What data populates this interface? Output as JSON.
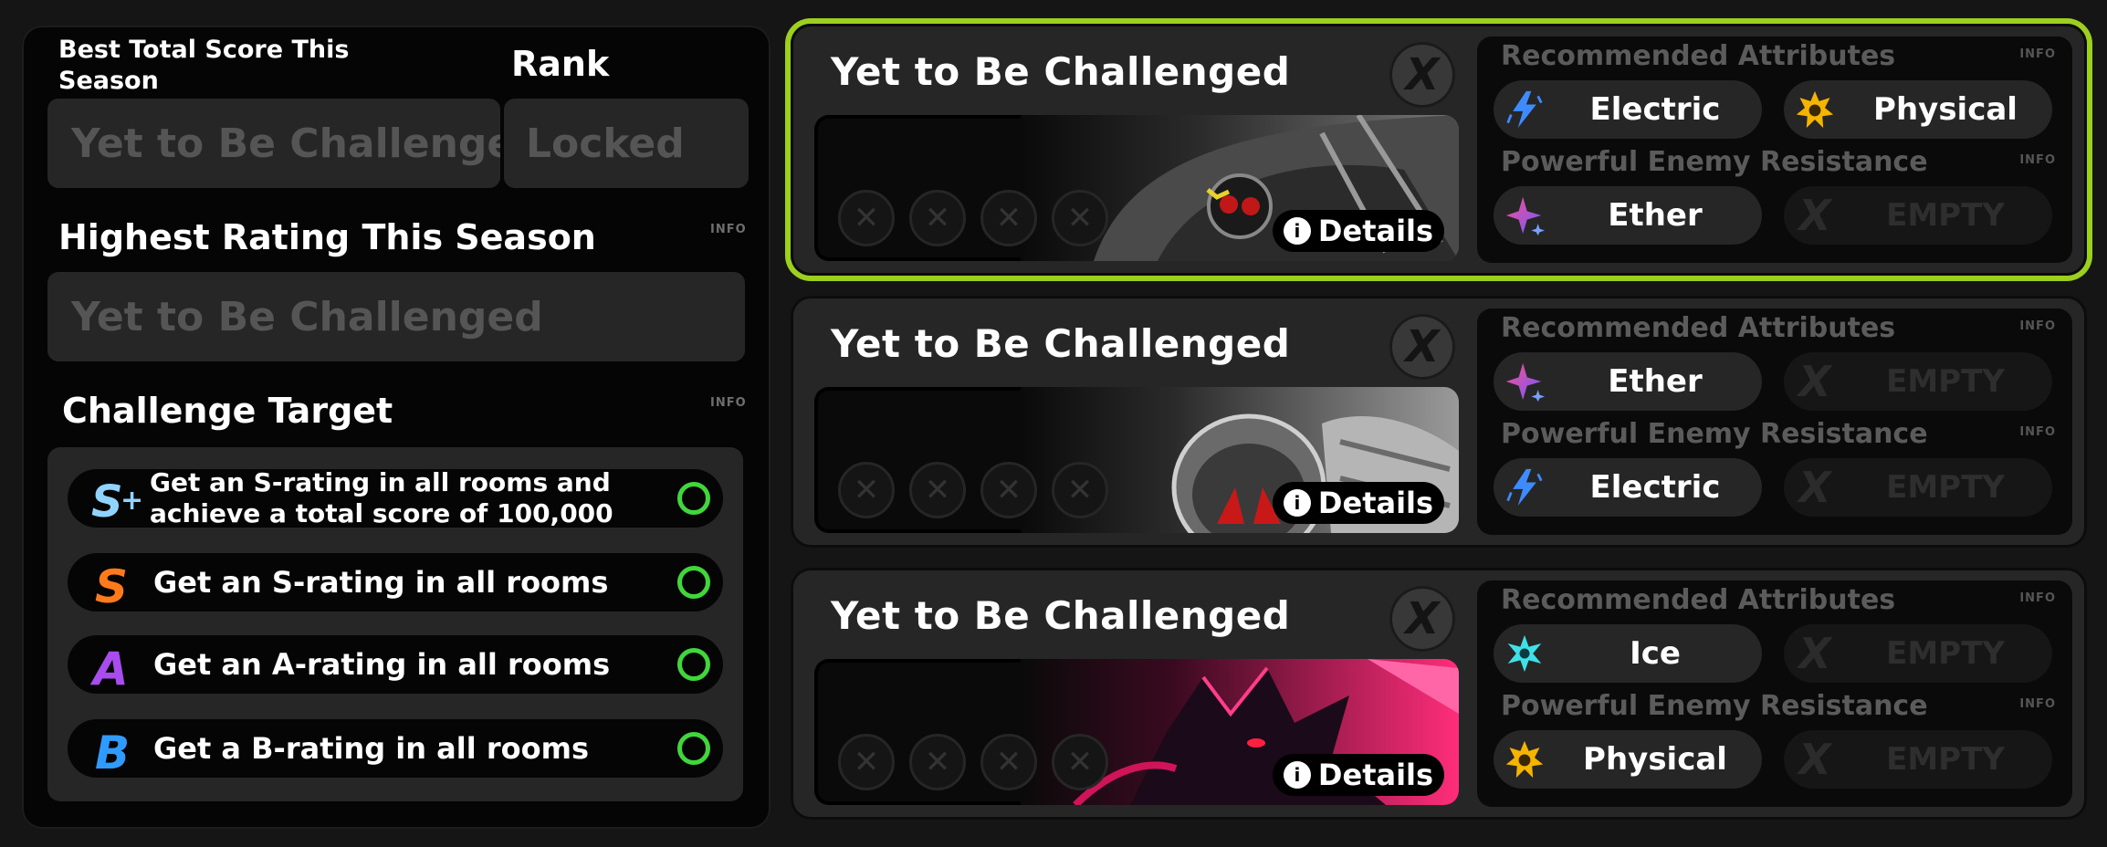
{
  "left": {
    "best_total_label": "Best Total Score This Season",
    "best_total_value": "Yet to Be Challenged",
    "rank_label": "Rank",
    "rank_value": "Locked",
    "highest_rating_label": "Highest Rating This Season",
    "highest_rating_value": "Yet to Be Challenged",
    "info_label": "INFO",
    "challenge_target_label": "Challenge Target",
    "targets": [
      {
        "badge": "S+",
        "text": "Get an S-rating in all rooms and achieve a total score of 100,000"
      },
      {
        "badge": "S",
        "text": "Get an S-rating in all rooms"
      },
      {
        "badge": "A",
        "text": "Get an A-rating in all rooms"
      },
      {
        "badge": "B",
        "text": "Get a B-rating in all rooms"
      }
    ]
  },
  "stages": [
    {
      "title": "Yet to Be Challenged",
      "close_glyph": "X",
      "details_label": "Details",
      "recommended_label": "Recommended Attributes",
      "resistance_label": "Powerful Enemy Resistance",
      "info_label": "INFO",
      "recommended": [
        {
          "name": "Electric",
          "icon": "electric-icon"
        },
        {
          "name": "Physical",
          "icon": "physical-icon"
        }
      ],
      "resistance": [
        {
          "name": "Ether",
          "icon": "ether-icon"
        },
        {
          "name": "EMPTY",
          "icon": "empty-icon"
        }
      ],
      "selected": true
    },
    {
      "title": "Yet to Be Challenged",
      "close_glyph": "X",
      "details_label": "Details",
      "recommended_label": "Recommended Attributes",
      "resistance_label": "Powerful Enemy Resistance",
      "info_label": "INFO",
      "recommended": [
        {
          "name": "Ether",
          "icon": "ether-icon"
        },
        {
          "name": "EMPTY",
          "icon": "empty-icon"
        }
      ],
      "resistance": [
        {
          "name": "Electric",
          "icon": "electric-icon"
        },
        {
          "name": "EMPTY",
          "icon": "empty-icon"
        }
      ],
      "selected": false
    },
    {
      "title": "Yet to Be Challenged",
      "close_glyph": "X",
      "details_label": "Details",
      "recommended_label": "Recommended Attributes",
      "resistance_label": "Powerful Enemy Resistance",
      "info_label": "INFO",
      "recommended": [
        {
          "name": "Ice",
          "icon": "ice-icon"
        },
        {
          "name": "EMPTY",
          "icon": "empty-icon"
        }
      ],
      "resistance": [
        {
          "name": "Physical",
          "icon": "physical-icon"
        },
        {
          "name": "EMPTY",
          "icon": "empty-icon"
        }
      ],
      "selected": false
    }
  ],
  "colors": {
    "selected_border": "#9ccf1e",
    "check_ring": "#3fd73a",
    "badge_s_plus": "#8fd3ff",
    "badge_s": "#ff7a1a",
    "badge_a": "#a84cf0",
    "badge_b": "#2f9bff"
  }
}
